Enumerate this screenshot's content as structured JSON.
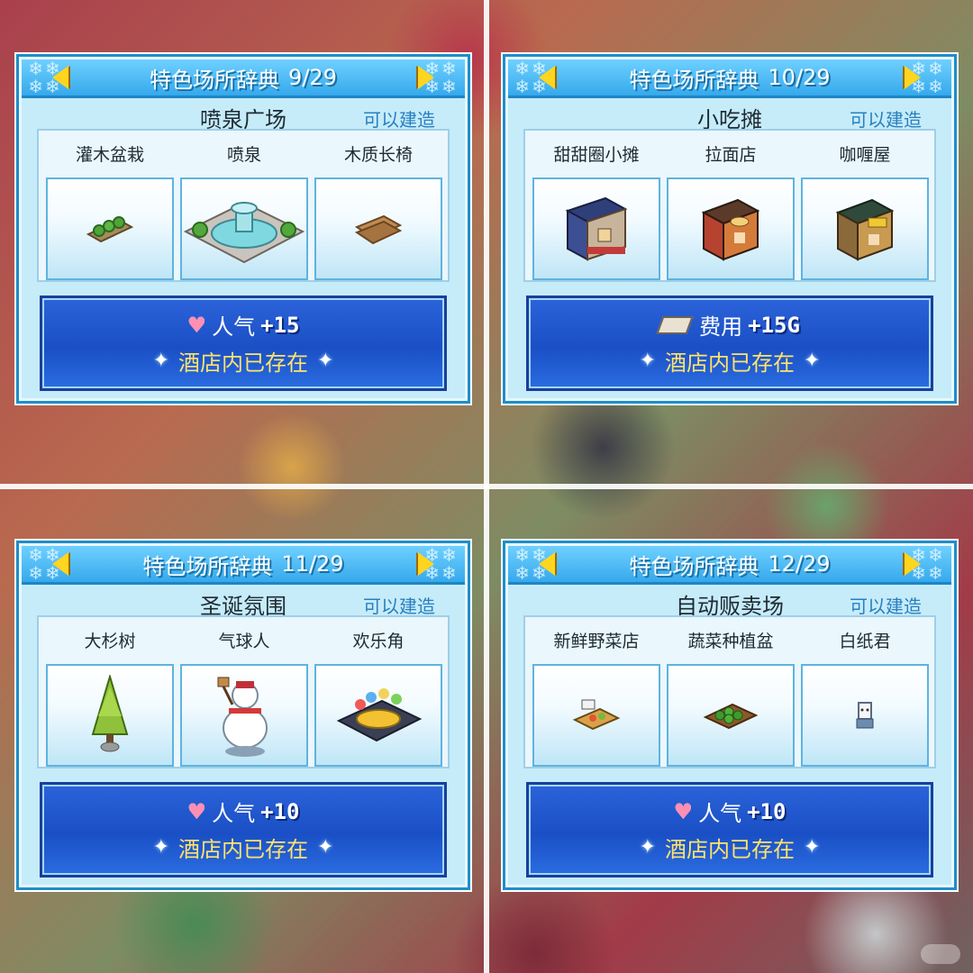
{
  "panels": [
    {
      "title": "特色场所辞典",
      "page": "9/29",
      "place": "喷泉广场",
      "status": "可以建造",
      "items": [
        {
          "label": "灌木盆栽",
          "icon": "shrub-planter-icon"
        },
        {
          "label": "喷泉",
          "icon": "fountain-icon"
        },
        {
          "label": "木质长椅",
          "icon": "wooden-bench-icon"
        }
      ],
      "bonus_label": "人气",
      "bonus_value": "+15",
      "bonus_icon": "heart-icon",
      "exists_text": "酒店内已存在"
    },
    {
      "title": "特色场所辞典",
      "page": "10/29",
      "place": "小吃摊",
      "status": "可以建造",
      "items": [
        {
          "label": "甜甜圈小摊",
          "icon": "donut-stall-icon"
        },
        {
          "label": "拉面店",
          "icon": "ramen-shop-icon"
        },
        {
          "label": "咖喱屋",
          "icon": "curry-house-icon"
        }
      ],
      "bonus_label": "费用",
      "bonus_value": "+15G",
      "bonus_icon": "ticket-icon",
      "exists_text": "酒店内已存在"
    },
    {
      "title": "特色场所辞典",
      "page": "11/29",
      "place": "圣诞氛围",
      "status": "可以建造",
      "items": [
        {
          "label": "大杉树",
          "icon": "cedar-tree-icon"
        },
        {
          "label": "气球人",
          "icon": "snowman-icon"
        },
        {
          "label": "欢乐角",
          "icon": "play-corner-icon"
        }
      ],
      "bonus_label": "人气",
      "bonus_value": "+10",
      "bonus_icon": "heart-icon",
      "exists_text": "酒店内已存在"
    },
    {
      "title": "特色场所辞典",
      "page": "12/29",
      "place": "自动贩卖场",
      "status": "可以建造",
      "items": [
        {
          "label": "新鲜野菜店",
          "icon": "vegetable-stand-icon"
        },
        {
          "label": "蔬菜种植盆",
          "icon": "vegetable-planter-icon"
        },
        {
          "label": "白纸君",
          "icon": "paper-mascot-icon"
        }
      ],
      "bonus_label": "人气",
      "bonus_value": "+10",
      "bonus_icon": "heart-icon",
      "exists_text": "酒店内已存在"
    }
  ],
  "colors": {
    "header": "#36a9ec",
    "panel_bg": "#c6ecf9",
    "info_bg": "#1a4fc5",
    "arrow": "#ffd51f",
    "exists_text": "#ffe36b",
    "status_text": "#2a7fc0"
  }
}
